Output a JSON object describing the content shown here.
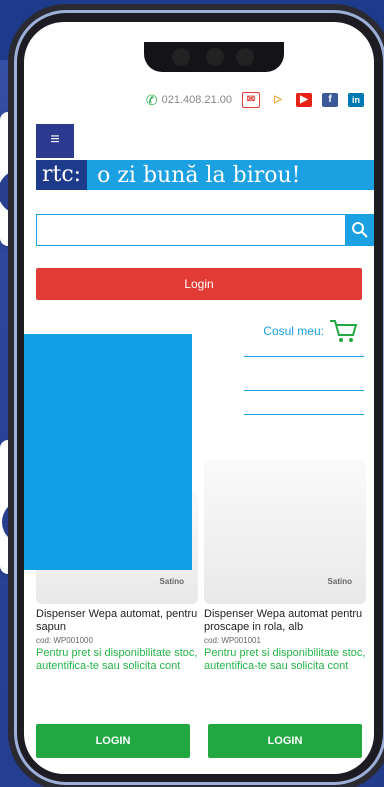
{
  "header": {
    "phone": "021.408.21.00",
    "icons": [
      "phone-icon",
      "mail-icon",
      "tag-icon",
      "youtube-icon",
      "facebook-icon",
      "linkedin-icon"
    ]
  },
  "brand": {
    "logo": "rtc:",
    "slogan": "o zi bună la birou!"
  },
  "search": {
    "placeholder": ""
  },
  "login_button": "Login",
  "cart": {
    "label": "Cosul meu:"
  },
  "products": [
    {
      "name": "Dispenser Wepa automat, pentru sapun",
      "code": "cod: WP001000",
      "message": "Pentru pret si disponibilitate stoc, autentifica-te sau solicita cont",
      "button": "LOGIN",
      "brand": "Satino"
    },
    {
      "name": "Dispenser Wepa automat pentru proscape in rola, alb",
      "code": "cod: WP001001",
      "message": "Pentru pret si disponibilitate stoc, autentifica-te sau solicita cont",
      "button": "LOGIN",
      "brand": "Satino"
    }
  ],
  "colors": {
    "blue": "#1ba0e2",
    "navy": "#1e3a8a",
    "red": "#e23b36",
    "green": "#22a843"
  }
}
